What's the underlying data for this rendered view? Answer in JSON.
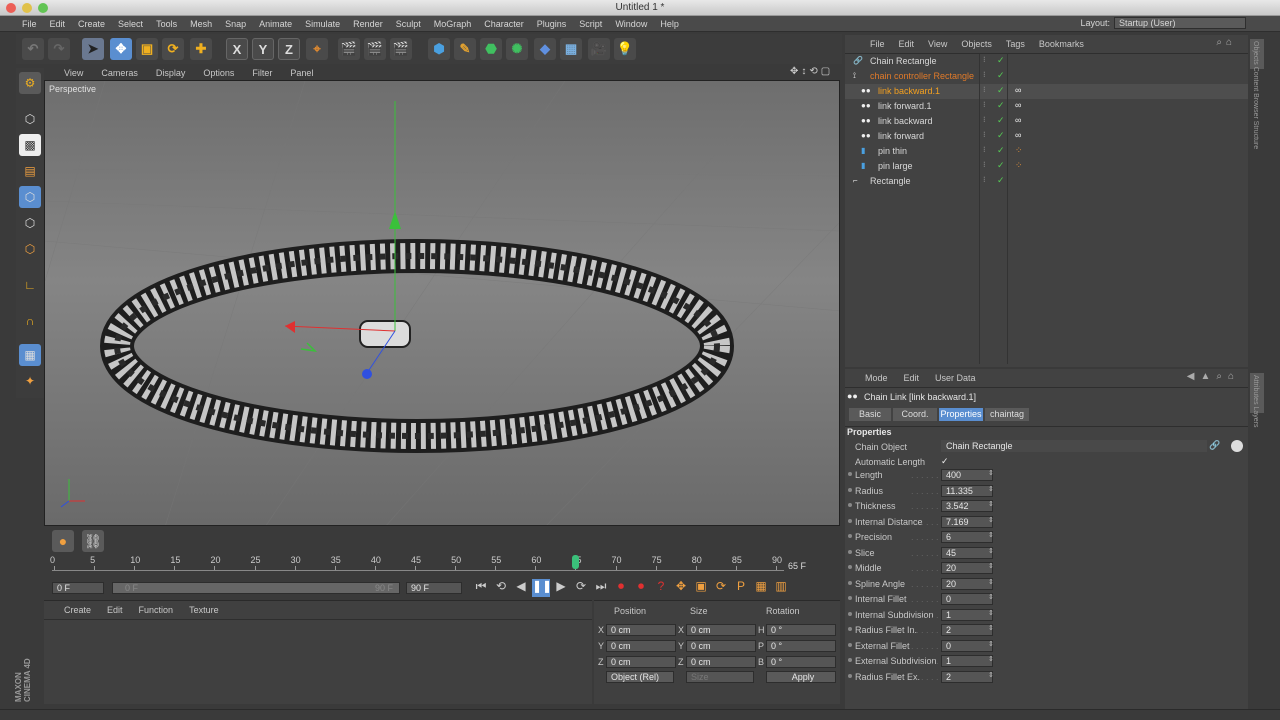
{
  "window": {
    "title": "Untitled 1 *"
  },
  "menu": [
    "File",
    "Edit",
    "Create",
    "Select",
    "Tools",
    "Mesh",
    "Snap",
    "Animate",
    "Simulate",
    "Render",
    "Sculpt",
    "MoGraph",
    "Character",
    "Plugins",
    "Script",
    "Window",
    "Help"
  ],
  "layout": {
    "label": "Layout:",
    "value": "Startup (User)"
  },
  "toolbar": {
    "x": "X",
    "y": "Y",
    "z": "Z"
  },
  "viewport": {
    "menu": [
      "View",
      "Cameras",
      "Display",
      "Options",
      "Filter",
      "Panel"
    ],
    "label": "Perspective"
  },
  "timeline": {
    "ticks": [
      "0",
      "5",
      "10",
      "15",
      "20",
      "25",
      "30",
      "35",
      "40",
      "45",
      "50",
      "55",
      "60",
      "65",
      "70",
      "75",
      "80",
      "85",
      "90"
    ],
    "current_frame_label": "65 F",
    "current_frame": 65,
    "max_frame": 90,
    "start_field": "0 F",
    "range_start": "0 F",
    "range_end": "90 F",
    "end_field": "90 F"
  },
  "material_manager": {
    "menu": [
      "Create",
      "Edit",
      "Function",
      "Texture"
    ]
  },
  "coord_manager": {
    "headers": {
      "position": "Position",
      "size": "Size",
      "rotation": "Rotation"
    },
    "rows": [
      {
        "pl": "X",
        "pv": "0 cm",
        "sl": "X",
        "sv": "0 cm",
        "rl": "H",
        "rv": "0 °"
      },
      {
        "pl": "Y",
        "pv": "0 cm",
        "sl": "Y",
        "sv": "0 cm",
        "rl": "P",
        "rv": "0 °"
      },
      {
        "pl": "Z",
        "pv": "0 cm",
        "sl": "Z",
        "sv": "0 cm",
        "rl": "B",
        "rv": "0 °"
      }
    ],
    "mode": "Object (Rel)",
    "size_mode": "Size",
    "apply": "Apply"
  },
  "object_manager": {
    "menu": [
      "File",
      "Edit",
      "View",
      "Objects",
      "Tags",
      "Bookmarks"
    ],
    "objects": [
      {
        "name": "Chain Rectangle",
        "color": "#d8d8d8"
      },
      {
        "name": "chain controller Rectangle",
        "color": "#e07a2a"
      },
      {
        "name": "link backward.1",
        "color": "#f3a020"
      },
      {
        "name": "link forward.1",
        "color": "#d8d8d8"
      },
      {
        "name": "link backward",
        "color": "#d8d8d8"
      },
      {
        "name": "link forward",
        "color": "#d8d8d8"
      },
      {
        "name": "pin thin",
        "color": "#d8d8d8"
      },
      {
        "name": "pin large",
        "color": "#d8d8d8"
      },
      {
        "name": "Rectangle",
        "color": "#d8d8d8"
      }
    ]
  },
  "attributes": {
    "menu": [
      "Mode",
      "Edit",
      "User Data"
    ],
    "object_title": "Chain Link [link backward.1]",
    "tabs": [
      "Basic",
      "Coord.",
      "Properties",
      "chaintag"
    ],
    "active_tab": "Properties",
    "section": "Properties",
    "chain_object_label": "Chain Object",
    "chain_object_value": "Chain Rectangle",
    "auto_length_label": "Automatic Length",
    "auto_length_value": "✓",
    "props": [
      {
        "label": "Length",
        "value": "400"
      },
      {
        "label": "Radius",
        "value": "11.335"
      },
      {
        "label": "Thickness",
        "value": "3.542"
      },
      {
        "label": "Internal Distance",
        "value": "7.169"
      },
      {
        "label": "Precision",
        "value": "6"
      },
      {
        "label": "Slice",
        "value": "45"
      },
      {
        "label": "Middle",
        "value": "20"
      },
      {
        "label": "Spline Angle",
        "value": "20"
      },
      {
        "label": "Internal Fillet",
        "value": "0"
      },
      {
        "label": "Internal Subdivision",
        "value": "1"
      },
      {
        "label": "Radius Fillet In.",
        "value": "2"
      },
      {
        "label": "External Fillet",
        "value": "0"
      },
      {
        "label": "External Subdivision",
        "value": "1"
      },
      {
        "label": "Radius Fillet Ex.",
        "value": "2"
      }
    ]
  },
  "brand": {
    "maxon": "MAXON",
    "product": "CINEMA 4D"
  },
  "side_tabs": [
    "Objects",
    "Content Browser",
    "Structure"
  ],
  "side_tabs_attr": [
    "Attributes",
    "Layers"
  ]
}
